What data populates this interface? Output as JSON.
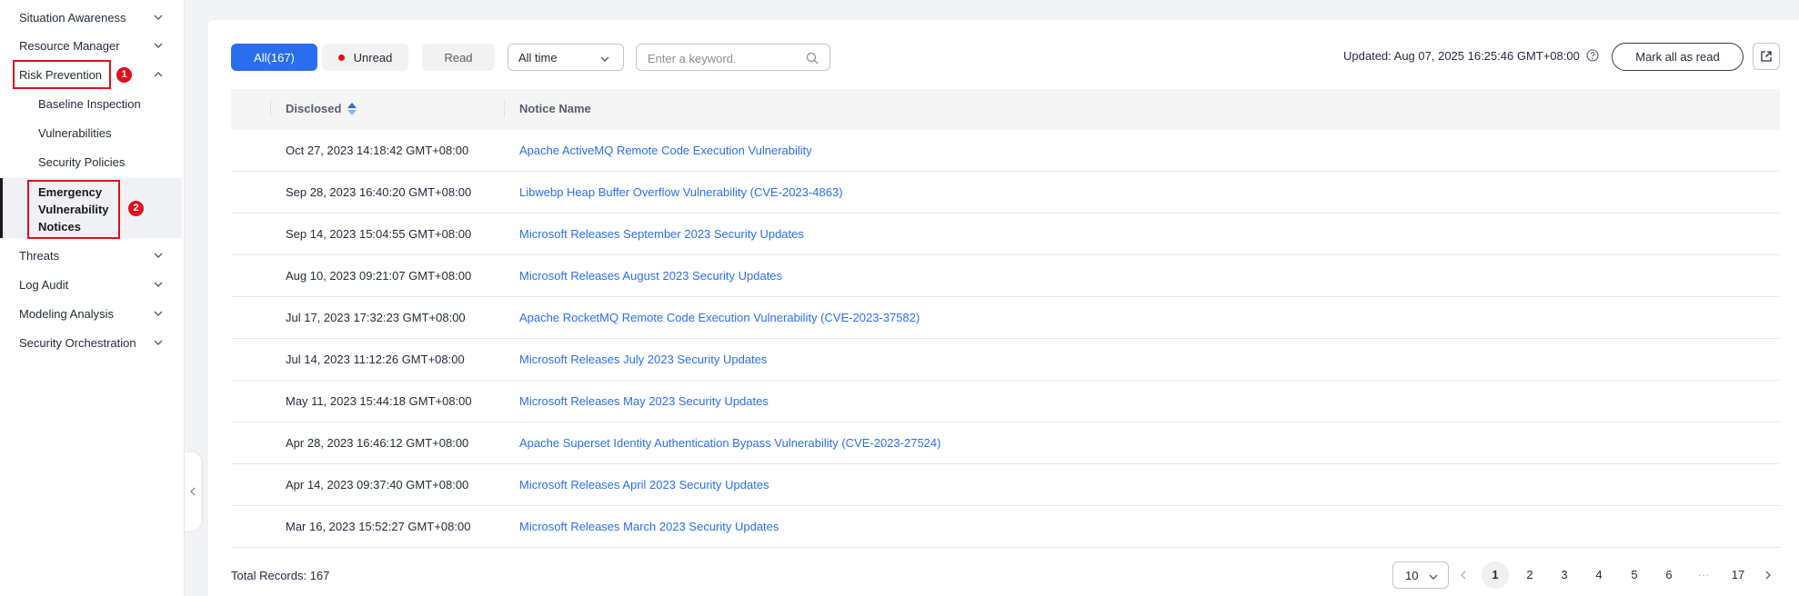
{
  "sidebar": {
    "items": [
      {
        "label": "Situation Awareness"
      },
      {
        "label": "Resource Manager"
      },
      {
        "label": "Risk Prevention"
      },
      {
        "label": "Threats"
      },
      {
        "label": "Log Audit"
      },
      {
        "label": "Modeling Analysis"
      },
      {
        "label": "Security Orchestration"
      }
    ],
    "sub_items": [
      {
        "label": "Baseline Inspection"
      },
      {
        "label": "Vulnerabilities"
      },
      {
        "label": "Security Policies"
      },
      {
        "label": "Emergency\nVulnerability\nNotices"
      }
    ],
    "markers": [
      "1",
      "2"
    ]
  },
  "toolbar": {
    "tabs": [
      {
        "label": "All(167)"
      },
      {
        "label": "Unread"
      },
      {
        "label": "Read"
      }
    ],
    "time_filter": "All time",
    "search_placeholder": "Enter a keyword.",
    "updated": "Updated: Aug 07, 2025 16:25:46 GMT+08:00",
    "mark_all_label": "Mark all as read"
  },
  "table": {
    "headers": {
      "disclosed": "Disclosed",
      "notice_name": "Notice Name"
    },
    "rows": [
      {
        "disclosed": "Oct 27, 2023 14:18:42 GMT+08:00",
        "name": "Apache ActiveMQ Remote Code Execution Vulnerability"
      },
      {
        "disclosed": "Sep 28, 2023 16:40:20 GMT+08:00",
        "name": "Libwebp Heap Buffer Overflow Vulnerability (CVE-2023-4863)"
      },
      {
        "disclosed": "Sep 14, 2023 15:04:55 GMT+08:00",
        "name": "Microsoft Releases September 2023 Security Updates"
      },
      {
        "disclosed": "Aug 10, 2023 09:21:07 GMT+08:00",
        "name": "Microsoft Releases August 2023 Security Updates"
      },
      {
        "disclosed": "Jul 17, 2023 17:32:23 GMT+08:00",
        "name": "Apache RocketMQ Remote Code Execution Vulnerability (CVE-2023-37582)"
      },
      {
        "disclosed": "Jul 14, 2023 11:12:26 GMT+08:00",
        "name": "Microsoft Releases July 2023 Security Updates"
      },
      {
        "disclosed": "May 11, 2023 15:44:18 GMT+08:00",
        "name": "Microsoft Releases May 2023 Security Updates"
      },
      {
        "disclosed": "Apr 28, 2023 16:46:12 GMT+08:00",
        "name": "Apache Superset Identity Authentication Bypass Vulnerability (CVE-2023-27524)"
      },
      {
        "disclosed": "Apr 14, 2023 09:37:40 GMT+08:00",
        "name": "Microsoft Releases April 2023 Security Updates"
      },
      {
        "disclosed": "Mar 16, 2023 15:52:27 GMT+08:00",
        "name": "Microsoft Releases March 2023 Security Updates"
      }
    ]
  },
  "footer": {
    "total": "Total Records: 167",
    "page_size": "10",
    "pages": [
      "1",
      "2",
      "3",
      "4",
      "5",
      "6"
    ],
    "ellipsis": "···",
    "last_page": "17"
  },
  "colors": {
    "accent": "#2a6ef0",
    "annotation": "#e0101c",
    "unread_dot": "#e0101c"
  }
}
